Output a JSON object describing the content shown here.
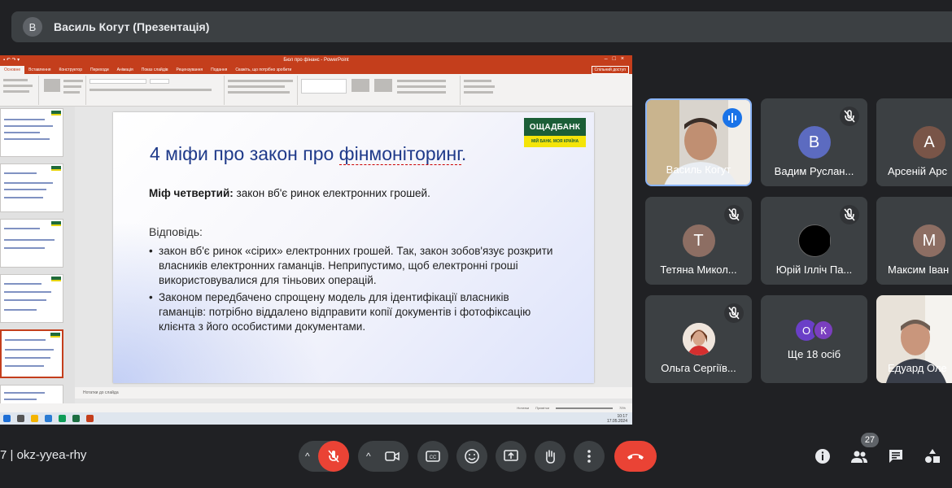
{
  "presenter_bar": {
    "avatar_letter": "В",
    "title": "Василь Когут (Презентація)"
  },
  "ppt": {
    "window_title": "Бюл про фінанс - PowerPoint",
    "tabs": [
      "Основне",
      "Вставлення",
      "Конструктор",
      "Переходи",
      "Анімація",
      "Показ слайдів",
      "Рецензування",
      "Подання",
      "Скажіть, що потрібно зробити"
    ],
    "share": "Спільний доступ",
    "notes_placeholder": "Нотатки до слайда",
    "status_items": [
      "Нотатки",
      "Примітки"
    ],
    "zoom": "70%",
    "clock": {
      "time": "10:17",
      "date": "17.05.2024"
    }
  },
  "slide": {
    "logo_top": "ОЩАДБАНК",
    "logo_bottom": "МІЙ БАНК. МОЯ КРАЇНА",
    "title_prefix": "4 міфи про закон про ",
    "title_underlined": "фінмоніторинг",
    "title_suffix": ".",
    "myth_label": "Міф четвертий:",
    "myth_text": " закон вб'є ринок електронних грошей.",
    "answer_label": "Відповідь:",
    "bullets": [
      " закон вб'є ринок «сірих» електронних грошей. Так, закон зобов'язує розкрити власників електронних гаманців. Неприпустимо, щоб електронні гроші використовувалися для тіньових операцій.",
      "Законом передбачено спрощену модель для ідентифікації власників гаманців: потрібно віддалено відправити копії документів і фотофіксацію клієнта з його особистими документами."
    ]
  },
  "participants": [
    {
      "name": "Василь Когут",
      "type": "video",
      "speaking": true
    },
    {
      "name": "Вадим Руслан...",
      "initial": "В",
      "color": "#5c6bc0",
      "muted": true
    },
    {
      "name": "Арсеній Арс",
      "initial": "А",
      "color": "#795548",
      "muted": true
    },
    {
      "name": "Тетяна Микол...",
      "initial": "Т",
      "color": "#8d6e63",
      "muted": true
    },
    {
      "name": "Юрій Ілліч Па...",
      "initial": "",
      "color": "#000000",
      "muted": true
    },
    {
      "name": "Максим Іван",
      "initial": "М",
      "color": "#8d6e63",
      "muted": true
    },
    {
      "name": "Ольга Сергіїв...",
      "initial": "",
      "color": "#e0c8b8",
      "muted": true
    },
    {
      "name": "Ще 18 осіб",
      "minis": [
        {
          "letter": "О",
          "color": "#6a3fc7"
        },
        {
          "letter": "К",
          "color": "#7b3fbf"
        }
      ]
    },
    {
      "name": "Едуард Оле",
      "type": "video"
    }
  ],
  "bottom": {
    "meeting_code": "7 | okz-yyea-rhy",
    "people_count": "27"
  }
}
